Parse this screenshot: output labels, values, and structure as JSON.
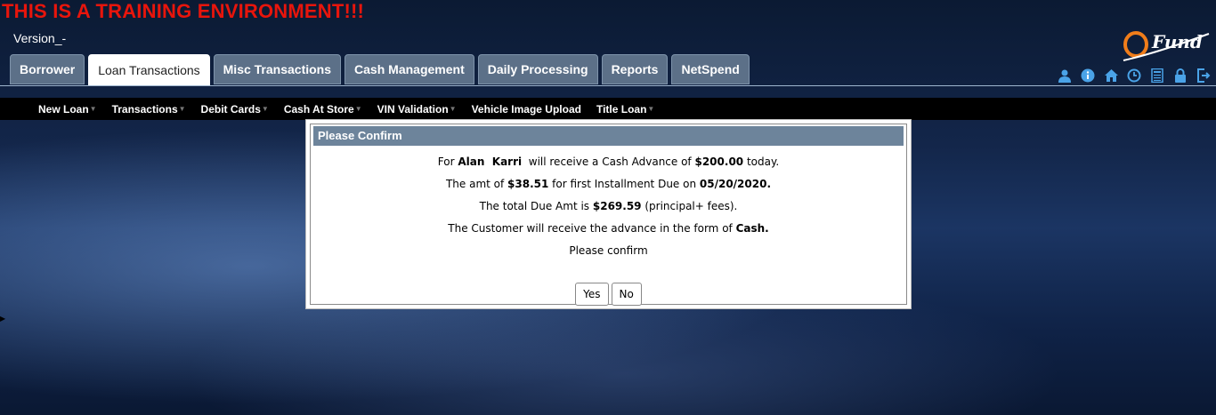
{
  "banner": "THIS IS A TRAINING ENVIRONMENT!!!",
  "version": "Version_-",
  "logo_text": "Fund",
  "tabs": [
    {
      "label": "Borrower"
    },
    {
      "label": "Loan Transactions",
      "active": true
    },
    {
      "label": "Misc Transactions"
    },
    {
      "label": "Cash Management"
    },
    {
      "label": "Daily Processing"
    },
    {
      "label": "Reports"
    },
    {
      "label": "NetSpend"
    }
  ],
  "toolbar_icons": [
    "user-icon",
    "info-icon",
    "home-icon",
    "clock-icon",
    "calculator-icon",
    "lock-icon",
    "logout-icon"
  ],
  "subnav": [
    "New Loan",
    "Transactions",
    "Debit Cards",
    "Cash At Store",
    "VIN Validation",
    "Vehicle Image Upload",
    "Title Loan"
  ],
  "dialog": {
    "title": "Please Confirm",
    "line1": {
      "pre": "For ",
      "name": "Alan  Karri",
      "mid": "  will receive a Cash Advance of ",
      "amount": "$200.00",
      "post": " today."
    },
    "line2": {
      "pre": "The amt of ",
      "amount": "$38.51",
      "mid": " for first Installment Due on ",
      "date": "05/20/2020."
    },
    "line3": {
      "pre": "The total Due Amt is ",
      "amount": "$269.59",
      "post": " (principal+ fees)."
    },
    "line4": {
      "pre": "The Customer will receive the advance in the form of ",
      "form": "Cash."
    },
    "line5": "Please confirm",
    "yes_label": "Yes",
    "no_label": "No"
  },
  "colors": {
    "banner": "#e8150c",
    "tab_bg": "#5c7088",
    "dialog_header": "#6d849b",
    "icon": "#4aa3e8"
  }
}
